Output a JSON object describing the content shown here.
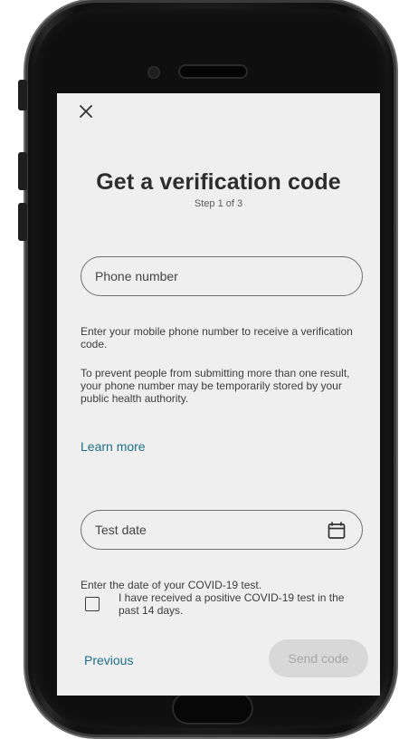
{
  "device": {
    "frame_color": "#1b1b1b",
    "screen_color": "#efefef"
  },
  "dialog": {
    "close_icon": "close-icon",
    "title": "Get a verification code",
    "step": "Step 1 of 3"
  },
  "phone": {
    "label": "Phone number",
    "help_text": "Enter your mobile phone number to receive a verification code.",
    "privacy_text": "To prevent people from submitting more than one result, your phone number may be temporarily stored by your public health authority.",
    "learn_more": "Learn more"
  },
  "test_date": {
    "label": "Test date",
    "icon": "calendar-icon",
    "help_text": "Enter the date of your COVID-19 test."
  },
  "positive_test": {
    "checked": false,
    "label": "I have received a positive COVID-19 test in the past 14 days."
  },
  "actions": {
    "previous": "Previous",
    "send_code": "Send code"
  },
  "colors": {
    "accent": "#1f6f86",
    "disabled_button": "#d8d8d8",
    "disabled_text": "#a7a7a7",
    "text": "#2b2b2b"
  }
}
